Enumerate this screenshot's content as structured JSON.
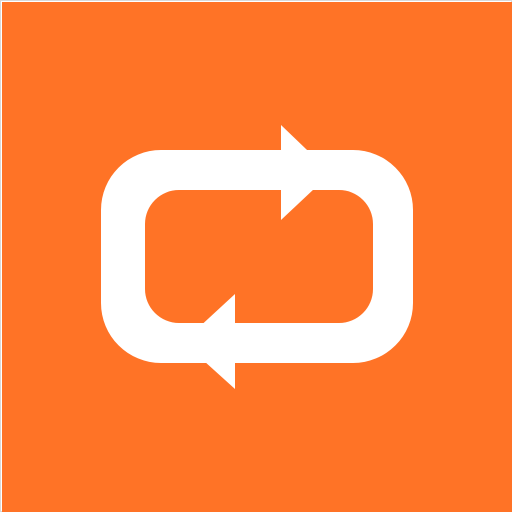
{
  "app_icon": {
    "icon": "repeat-icon",
    "background_color": "#FF7326",
    "glyph_color": "#FFFFFF",
    "border_color": "#D9D9D9"
  }
}
